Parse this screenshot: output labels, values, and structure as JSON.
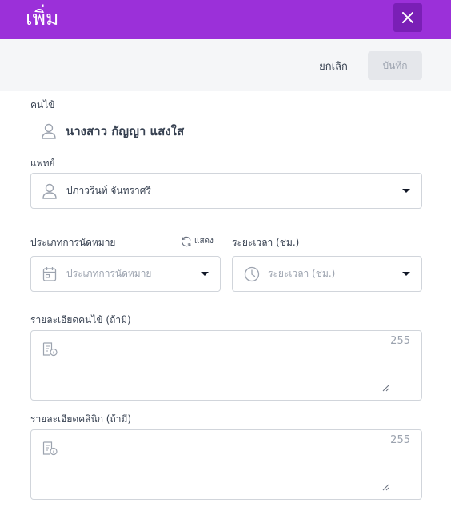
{
  "header": {
    "title": "เพิ่ม",
    "close_icon": "close-icon",
    "background": "#9b30d9"
  },
  "actions": {
    "cancel_label": "ยกเลิก",
    "save_label": "บันทึก"
  },
  "patient": {
    "label": "คนไข้",
    "name": "นางสาว กัญญา แสงใส",
    "icon": "user-icon"
  },
  "doctor": {
    "label": "แพทย์",
    "value": "ปภาวรินท์ จันทราศรี",
    "icon": "user-icon"
  },
  "appointment_type": {
    "label": "ประเภทการนัดหมาย",
    "placeholder": "ประเภทการนัดหมาย",
    "toggle_label": "แสดง",
    "icon": "calendar-icon"
  },
  "duration": {
    "label": "ระยะเวลา (ชม.)",
    "placeholder": "ระยะเวลา (ชม.)",
    "icon": "clock-icon"
  },
  "patient_details": {
    "label": "รายละเอียดคนไข้ (ถ้ามี)",
    "counter": "255",
    "value": ""
  },
  "clinic_details": {
    "label": "รายละเอียดคลินิก (ถ้ามี)",
    "counter": "255",
    "value": ""
  }
}
